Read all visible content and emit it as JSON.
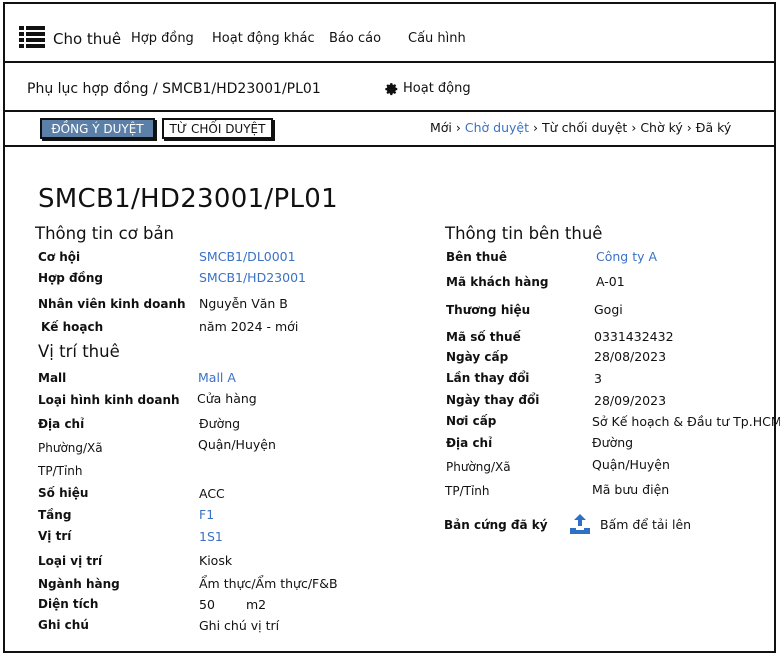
{
  "nav": {
    "brand": "Cho thuê",
    "items": [
      "Hợp đồng",
      "Hoạt động khác",
      "Báo cáo",
      "Cấu hình"
    ]
  },
  "breadcrumb": "Phụ lục hợp đồng / SMCB1/HD23001/PL01",
  "activity_label": "Hoạt động",
  "actions": {
    "approve": "ĐỒNG Ý DUYỆT",
    "reject": "TỪ CHỐI DUYỆT"
  },
  "workflow": {
    "steps": [
      "Mới",
      "Chờ duyệt",
      "Từ chối duyệt",
      "Chờ ký",
      "Đã ký"
    ],
    "active": "Chờ duyệt"
  },
  "title": "SMCB1/HD23001/PL01",
  "basic": {
    "heading": "Thông tin cơ bản",
    "rows": [
      {
        "label": "Cơ hội",
        "value": "SMCB1/DL0001"
      },
      {
        "label": "Hợp đồng",
        "value": "SMCB1/HD23001"
      },
      {
        "label": "Nhân viên kinh doanh",
        "value": "Nguyễn Văn B"
      },
      {
        "label": "Kế hoạch",
        "value": "năm 2024 - mới"
      }
    ]
  },
  "location": {
    "heading": "Vị trí thuê",
    "rows": [
      {
        "label": "Mall",
        "value": "Mall A"
      },
      {
        "label": "Loại hình kinh doanh",
        "value": "Cửa hàng"
      },
      {
        "label": "Địa chỉ",
        "value": "Đường"
      },
      {
        "label": "Phường/Xã",
        "value": "Quận/Huyện"
      },
      {
        "label": "TP/Tỉnh",
        "value": ""
      },
      {
        "label": "Số hiệu",
        "value": "ACC"
      },
      {
        "label": "Tầng",
        "value": "F1"
      },
      {
        "label": "Vị trí",
        "value": "1S1"
      },
      {
        "label": "Loại vị trí",
        "value": "Kiosk"
      },
      {
        "label": "Ngành hàng",
        "value": "Ẩm thực/Ẩm thực/F&B"
      },
      {
        "label": "Diện tích",
        "value": "50",
        "unit": "m2"
      },
      {
        "label": "Ghi chú",
        "value": "Ghi chú vị trí"
      }
    ]
  },
  "tenant": {
    "heading": "Thông tin bên thuê",
    "rows": [
      {
        "label": "Bên thuê",
        "value": "Công ty A"
      },
      {
        "label": "Mã khách hàng",
        "value": "A-01"
      },
      {
        "label": "Thương hiệu",
        "value": "Gogi"
      },
      {
        "label": "Mã số thuế",
        "value": "0331432432"
      },
      {
        "label": "Ngày cấp",
        "value": "28/08/2023"
      },
      {
        "label": "Lần thay đổi",
        "value": "3"
      },
      {
        "label": "Ngày thay đổi",
        "value": "28/09/2023"
      },
      {
        "label": "Nơi cấp",
        "value": "Sở Kế hoạch & Đầu tư Tp.HCM"
      },
      {
        "label": "Địa chỉ",
        "value": "Đường"
      },
      {
        "label": "Phường/Xã",
        "value": "Quận/Huyện"
      },
      {
        "label": "TP/Tỉnh",
        "value": "Mã bưu điện"
      }
    ],
    "signed_copy_label": "Bản cứng đã ký",
    "upload_label": "Bấm để tải lên"
  },
  "colors": {
    "link": "#3b72c4",
    "approve_bg": "#5b7fa6",
    "upload_icon": "#2f6fc4"
  }
}
